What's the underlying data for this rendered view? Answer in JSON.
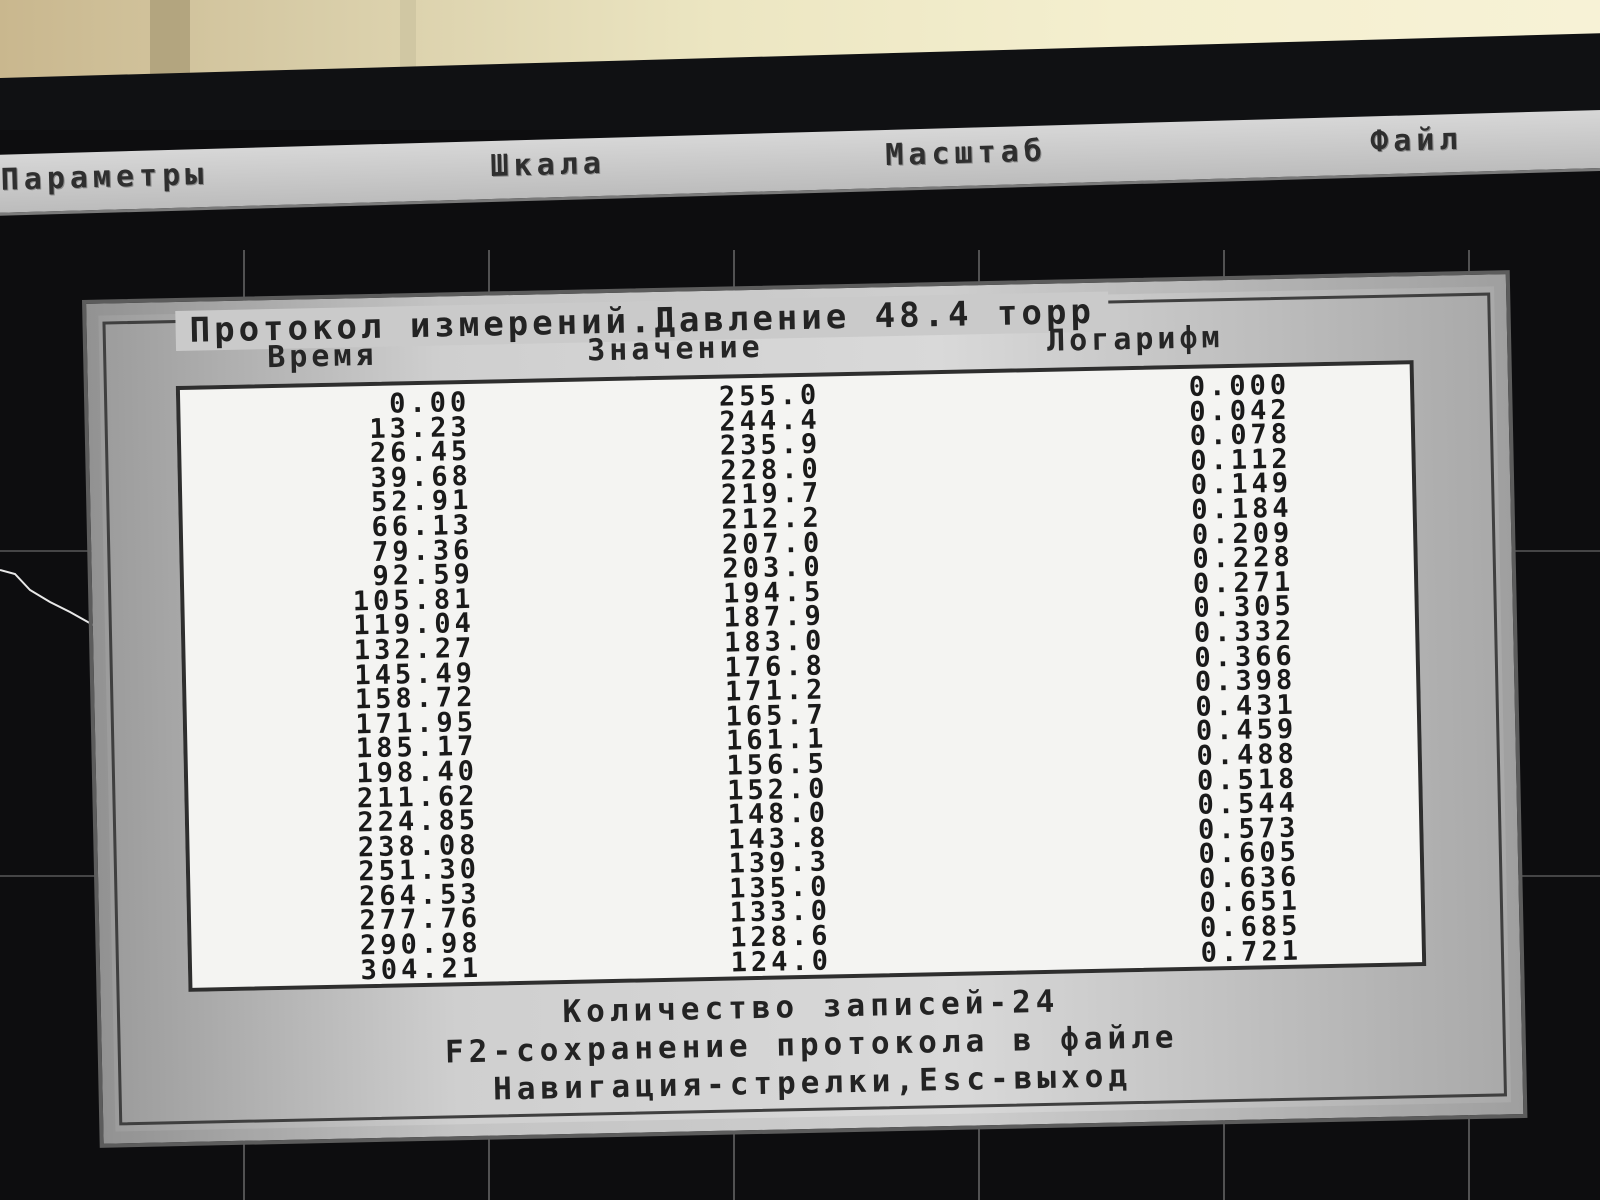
{
  "menu": {
    "items": [
      "Параметры",
      "Шкала",
      "Масштаб",
      "Файл"
    ]
  },
  "dialog": {
    "title": "Протокол измерений.Давление 48.4 торр",
    "columns": {
      "time": "Время",
      "value": "Значение",
      "log": "Логарифм"
    },
    "rows": [
      {
        "time": "0.00",
        "value": "255.0",
        "log": "0.000"
      },
      {
        "time": "13.23",
        "value": "244.4",
        "log": "0.042"
      },
      {
        "time": "26.45",
        "value": "235.9",
        "log": "0.078"
      },
      {
        "time": "39.68",
        "value": "228.0",
        "log": "0.112"
      },
      {
        "time": "52.91",
        "value": "219.7",
        "log": "0.149"
      },
      {
        "time": "66.13",
        "value": "212.2",
        "log": "0.184"
      },
      {
        "time": "79.36",
        "value": "207.0",
        "log": "0.209"
      },
      {
        "time": "92.59",
        "value": "203.0",
        "log": "0.228"
      },
      {
        "time": "105.81",
        "value": "194.5",
        "log": "0.271"
      },
      {
        "time": "119.04",
        "value": "187.9",
        "log": "0.305"
      },
      {
        "time": "132.27",
        "value": "183.0",
        "log": "0.332"
      },
      {
        "time": "145.49",
        "value": "176.8",
        "log": "0.366"
      },
      {
        "time": "158.72",
        "value": "171.2",
        "log": "0.398"
      },
      {
        "time": "171.95",
        "value": "165.7",
        "log": "0.431"
      },
      {
        "time": "185.17",
        "value": "161.1",
        "log": "0.459"
      },
      {
        "time": "198.40",
        "value": "156.5",
        "log": "0.488"
      },
      {
        "time": "211.62",
        "value": "152.0",
        "log": "0.518"
      },
      {
        "time": "224.85",
        "value": "148.0",
        "log": "0.544"
      },
      {
        "time": "238.08",
        "value": "143.8",
        "log": "0.573"
      },
      {
        "time": "251.30",
        "value": "139.3",
        "log": "0.605"
      },
      {
        "time": "264.53",
        "value": "135.0",
        "log": "0.636"
      },
      {
        "time": "277.76",
        "value": "133.0",
        "log": "0.651"
      },
      {
        "time": "290.98",
        "value": "128.6",
        "log": "0.685"
      },
      {
        "time": "304.21",
        "value": "124.0",
        "log": "0.721"
      }
    ],
    "footer": {
      "count": "Количество записей-24",
      "save_hint": "F2-сохранение протокола в файле",
      "nav_hint": "Навигация-стрелки,Esc-выход"
    }
  },
  "colors": {
    "screen_bg": "#0d0d0f",
    "menu_bg": "#c8c8c8",
    "dialog_bg": "#cfcfcf",
    "table_bg": "#f4f4f2",
    "text": "#1a1a1a"
  }
}
